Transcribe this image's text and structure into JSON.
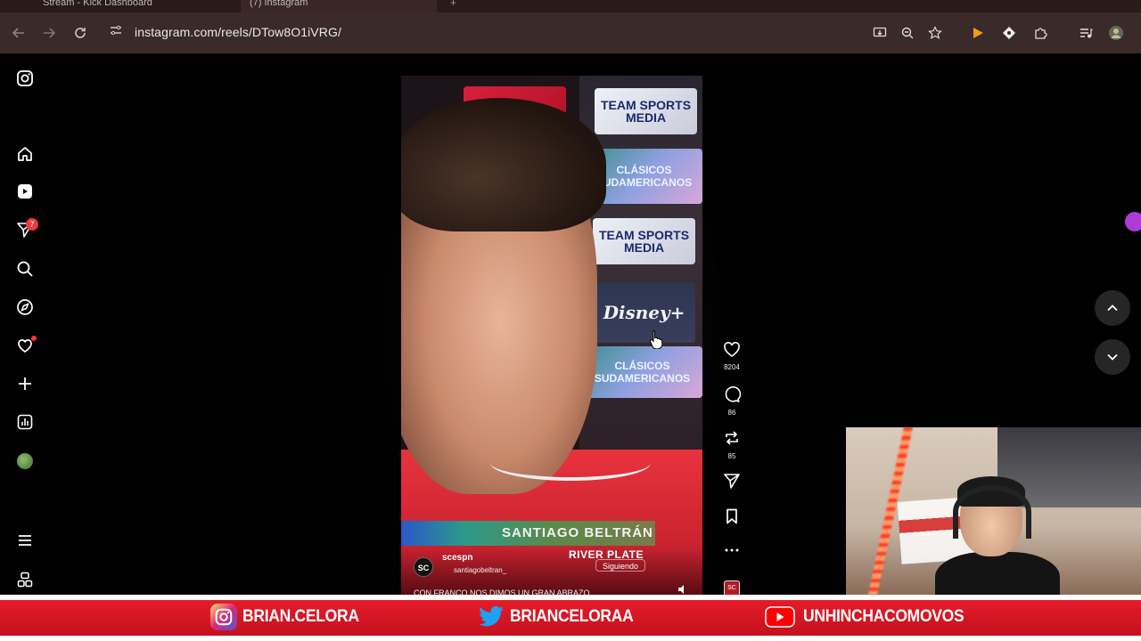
{
  "browser": {
    "tabs": [
      {
        "label": "Stream - Kick Dashboard"
      },
      {
        "label": "(7) Instagram"
      }
    ],
    "url": "instagram.com/reels/DTow8O1iVRG/",
    "toolbar_icons": [
      "back-icon",
      "forward-icon",
      "reload-icon",
      "site-settings-icon",
      "install-app-icon",
      "zoom-icon",
      "bookmark-star-icon",
      "extension-play-icon",
      "extension-diamond-icon",
      "extensions-puzzle-icon",
      "media-control-icon",
      "profile-icon"
    ]
  },
  "instagram_nav": {
    "items": [
      {
        "name": "instagram-logo-icon"
      },
      {
        "name": "home-icon"
      },
      {
        "name": "reels-icon"
      },
      {
        "name": "messages-icon",
        "badge": "7"
      },
      {
        "name": "search-icon"
      },
      {
        "name": "explore-icon"
      },
      {
        "name": "notifications-icon"
      },
      {
        "name": "create-icon"
      },
      {
        "name": "dashboard-icon"
      },
      {
        "name": "profile-avatar"
      },
      {
        "name": "more-menu-icon"
      },
      {
        "name": "also-from-meta-icon"
      }
    ]
  },
  "reel": {
    "sponsors": [
      "TEAM SPORTS MEDIA",
      "CLÁSICOS SUDAMERICANOS",
      "Disney+"
    ],
    "player_name": "SANTIAGO BELTRÁN",
    "club": "RIVER PLATE",
    "account": "scespn",
    "account_avatar": "SC",
    "collaborator": "santiagobeltran_",
    "follow_status": "Siguiendo",
    "caption": "CON FRANCO NOS DIMOS UN GRAN ABRAZO"
  },
  "actions": {
    "likes": "8204",
    "comments": "86",
    "reposts": "85",
    "audio_label": "SC"
  },
  "overlay": {
    "instagram_handle": "BRIAN.CELORA",
    "twitter_handle": "BRIANCELORAA",
    "youtube_handle": "UNHINCHACOMOVOS",
    "colors": {
      "banner_red": "#d8182a",
      "instagram_accent": "#e1306c",
      "twitter_blue": "#1da1f2",
      "youtube_red": "#ff0000"
    }
  }
}
